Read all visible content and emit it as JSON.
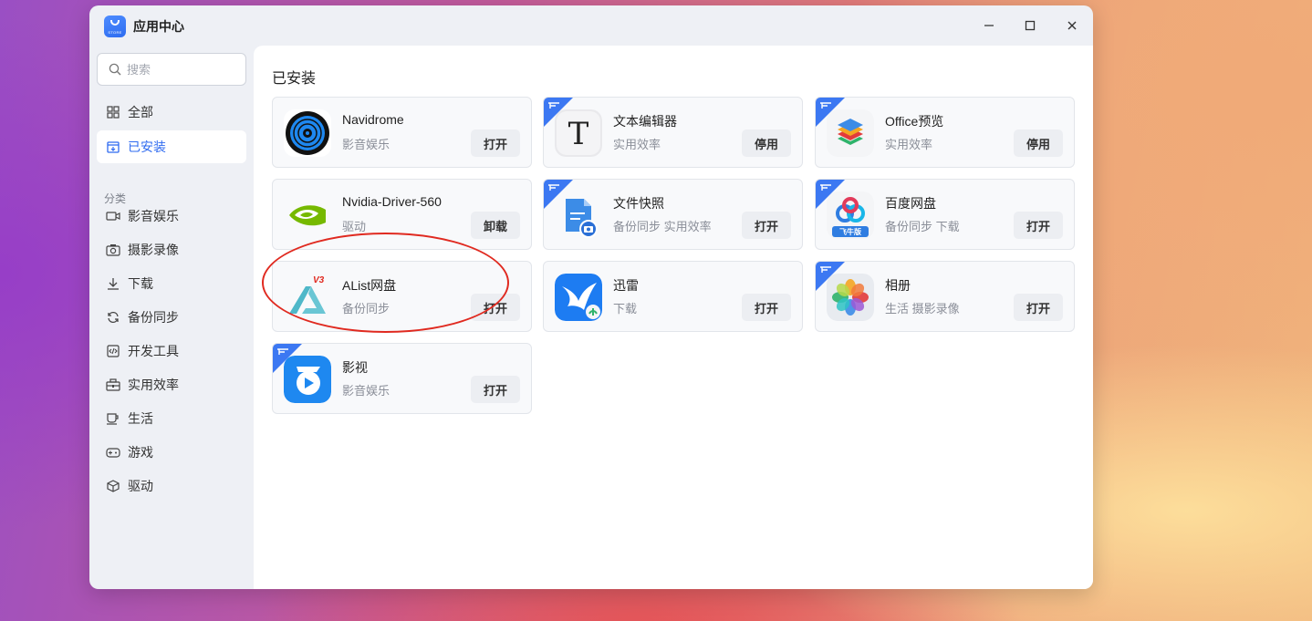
{
  "window": {
    "title": "应用中心",
    "logo_text": "STORE",
    "controls": [
      "minimize",
      "maximize",
      "close"
    ]
  },
  "sidebar": {
    "search_placeholder": "搜索",
    "top_items": [
      {
        "label": "全部",
        "icon": "grid-icon",
        "active": false
      },
      {
        "label": "已安装",
        "icon": "installed-icon",
        "active": true
      }
    ],
    "section_label": "分类",
    "categories": [
      {
        "label": "影音娱乐",
        "icon": "video-icon"
      },
      {
        "label": "摄影录像",
        "icon": "camera-icon"
      },
      {
        "label": "下载",
        "icon": "download-icon"
      },
      {
        "label": "备份同步",
        "icon": "sync-icon"
      },
      {
        "label": "开发工具",
        "icon": "code-icon"
      },
      {
        "label": "实用效率",
        "icon": "toolbox-icon"
      },
      {
        "label": "生活",
        "icon": "cup-icon"
      },
      {
        "label": "游戏",
        "icon": "gamepad-icon"
      },
      {
        "label": "驱动",
        "icon": "cube-icon"
      }
    ]
  },
  "main": {
    "title": "已安装",
    "apps": [
      {
        "name": "Navidrome",
        "category": "影音娱乐",
        "button": "打开",
        "icon": "navidrome-disc-icon",
        "ribbon": false
      },
      {
        "name": "文本编辑器",
        "category": "实用效率",
        "button": "停用",
        "icon": "text-editor-icon",
        "ribbon": true
      },
      {
        "name": "Office预览",
        "category": "实用效率",
        "button": "停用",
        "icon": "office-layers-icon",
        "ribbon": true
      },
      {
        "name": "Nvidia-Driver-560",
        "category": "驱动",
        "button": "卸载",
        "icon": "nvidia-eye-icon",
        "ribbon": false
      },
      {
        "name": "文件快照",
        "category": "备份同步 实用效率",
        "button": "打开",
        "icon": "file-snapshot-icon",
        "ribbon": true
      },
      {
        "name": "百度网盘",
        "category": "备份同步 下载",
        "button": "打开",
        "icon": "baidu-netdisk-icon",
        "ribbon": true,
        "badge": "飞牛版"
      },
      {
        "name": "AList网盘",
        "category": "备份同步",
        "button": "打开",
        "icon": "alist-icon",
        "ribbon": false,
        "badge": "V3"
      },
      {
        "name": "迅雷",
        "category": "下载",
        "button": "打开",
        "icon": "thunder-bird-icon",
        "ribbon": false
      },
      {
        "name": "相册",
        "category": "生活 摄影录像",
        "button": "打开",
        "icon": "photos-flower-icon",
        "ribbon": true
      },
      {
        "name": "影视",
        "category": "影音娱乐",
        "button": "打开",
        "icon": "video-play-icon",
        "ribbon": true
      }
    ]
  },
  "colors": {
    "accent": "#2f6bf0",
    "ribbon": "#3c78f2",
    "annotation": "#e02a20"
  }
}
